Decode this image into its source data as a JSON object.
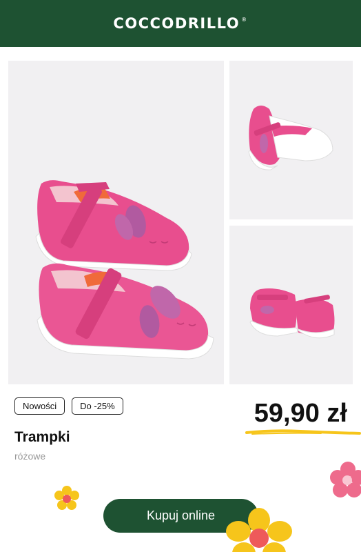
{
  "header": {
    "brand": "COCCODRILLO",
    "trademark": "®",
    "background": "#1e5232"
  },
  "gallery": {
    "images": [
      {
        "name": "pink-shoes-side-view"
      },
      {
        "name": "pink-shoes-back-view"
      },
      {
        "name": "pink-shoes-rear-view"
      }
    ],
    "background": "#f1f0f2"
  },
  "product": {
    "tags": [
      "Nowości",
      "Do -25%"
    ],
    "price": "59,90 zł",
    "title": "Trampki",
    "color": "różowe"
  },
  "cta": {
    "label": "Kupuj online",
    "color": "#1e5232"
  },
  "accents": {
    "yellow": "#f6c51b",
    "pink": "#ee6b8c",
    "shoe_pink": "#e84e8e"
  }
}
